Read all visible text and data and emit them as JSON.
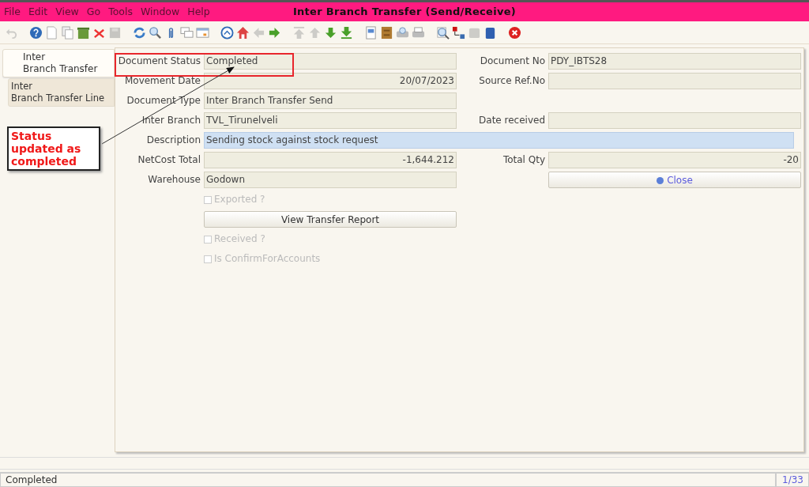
{
  "window": {
    "title": "Inter Branch Transfer (Send/Receive)"
  },
  "menu": [
    "File",
    "Edit",
    "View",
    "Go",
    "Tools",
    "Window",
    "Help"
  ],
  "toolbar": [
    {
      "kind": "undo",
      "disabled": true
    },
    {
      "kind": "gap"
    },
    {
      "kind": "help",
      "disabled": false
    },
    {
      "kind": "new",
      "disabled": false
    },
    {
      "kind": "copy",
      "disabled": false
    },
    {
      "kind": "bin",
      "disabled": false
    },
    {
      "kind": "cross",
      "disabled": false
    },
    {
      "kind": "save",
      "disabled": true
    },
    {
      "kind": "gap"
    },
    {
      "kind": "refresh",
      "disabled": false
    },
    {
      "kind": "find",
      "disabled": false
    },
    {
      "kind": "clip",
      "disabled": false
    },
    {
      "kind": "chat",
      "disabled": false
    },
    {
      "kind": "grid",
      "disabled": false
    },
    {
      "kind": "gap"
    },
    {
      "kind": "history",
      "disabled": false
    },
    {
      "kind": "home",
      "disabled": false
    },
    {
      "kind": "left",
      "disabled": true
    },
    {
      "kind": "right",
      "disabled": false
    },
    {
      "kind": "gap"
    },
    {
      "kind": "first",
      "disabled": true
    },
    {
      "kind": "up",
      "disabled": true
    },
    {
      "kind": "down",
      "disabled": false
    },
    {
      "kind": "last",
      "disabled": false
    },
    {
      "kind": "gap"
    },
    {
      "kind": "report",
      "disabled": false
    },
    {
      "kind": "archive",
      "disabled": false
    },
    {
      "kind": "printpreview",
      "disabled": false
    },
    {
      "kind": "print",
      "disabled": false
    },
    {
      "kind": "gap"
    },
    {
      "kind": "zoom",
      "disabled": false
    },
    {
      "kind": "workflow",
      "disabled": false
    },
    {
      "kind": "box",
      "disabled": true
    },
    {
      "kind": "cube",
      "disabled": false
    },
    {
      "kind": "gap"
    },
    {
      "kind": "close",
      "disabled": false
    }
  ],
  "tabs": [
    {
      "lines": [
        "Inter",
        "Branch Transfer"
      ],
      "selected": true
    },
    {
      "lines": [
        "Inter",
        "Branch Transfer Line"
      ],
      "selected": false
    }
  ],
  "rows": [
    {
      "left": {
        "kind": "field",
        "label": "Document Status",
        "value": "Completed"
      },
      "right": {
        "kind": "field",
        "label": "Document No",
        "value": "PDY_IBTS28"
      }
    },
    {
      "left": {
        "kind": "number",
        "label": "Movement Date",
        "value": "20/07/2023"
      },
      "right": {
        "kind": "field",
        "label": "Source Ref.No"
      }
    },
    {
      "left": {
        "kind": "field",
        "label": "Document Type",
        "value": "Inter Branch Transfer Send"
      }
    },
    {
      "left": {
        "kind": "field",
        "label": "Inter Branch",
        "value": "TVL_Tirunelveli"
      },
      "right": {
        "kind": "field",
        "label": "Date received"
      }
    },
    {
      "left": {
        "kind": "wide",
        "label": "Description",
        "value": "Sending stock against stock request"
      }
    },
    {
      "left": {
        "kind": "number",
        "label": "NetCost Total",
        "value": "-1,644.212"
      },
      "right": {
        "kind": "number",
        "label": "Total Qty",
        "value": "-20"
      }
    },
    {
      "left": {
        "kind": "field",
        "label": "Warehouse",
        "value": "Godown"
      },
      "right": {
        "kind": "button",
        "label": "Close",
        "icon": true
      }
    },
    {
      "left": {
        "kind": "checkbox",
        "label": "Exported ?",
        "checked": false,
        "disabled": true
      }
    },
    {
      "left": {
        "kind": "button",
        "label": "View Transfer Report",
        "icon": false
      }
    },
    {
      "left": {
        "kind": "checkbox",
        "label": "Received ?",
        "checked": false,
        "disabled": true
      }
    },
    {
      "left": {
        "kind": "checkbox",
        "label": "Is ConfirmForAccounts",
        "checked": false,
        "disabled": true
      }
    }
  ],
  "annotation": {
    "text": "Status updated as completed"
  },
  "status_bar": {
    "message": "Completed",
    "record": "1/33"
  }
}
